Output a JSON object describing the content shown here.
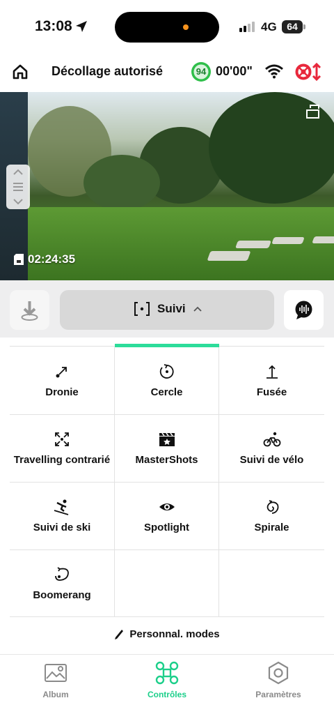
{
  "status_bar": {
    "time": "13:08",
    "network": "4G",
    "battery": "64",
    "signal_bars_active": 2,
    "signal_bars_total": 4
  },
  "header": {
    "title": "Décollage autorisé",
    "drone_battery": "94",
    "flight_time": "00'00\"",
    "icons": [
      "home-icon",
      "wifi-icon",
      "alert-icon"
    ]
  },
  "video": {
    "recording_time": "02:24:35"
  },
  "mode_selector": {
    "label": "Suivi"
  },
  "modes": [
    {
      "label": "Dronie",
      "icon": "dronie-icon"
    },
    {
      "label": "Cercle",
      "icon": "circle-icon"
    },
    {
      "label": "Fusée",
      "icon": "rocket-icon"
    },
    {
      "label": "Travelling contrarié",
      "icon": "travelling-icon"
    },
    {
      "label": "MasterShots",
      "icon": "clapper-icon"
    },
    {
      "label": "Suivi de vélo",
      "icon": "bike-icon"
    },
    {
      "label": "Suivi de ski",
      "icon": "ski-icon"
    },
    {
      "label": "Spotlight",
      "icon": "eye-icon"
    },
    {
      "label": "Spirale",
      "icon": "spiral-icon"
    },
    {
      "label": "Boomerang",
      "icon": "boomerang-icon"
    }
  ],
  "custom_modes_label": "Personnal. modes",
  "bottom_nav": {
    "album": "Album",
    "controls": "Contrôles",
    "settings": "Paramètres"
  },
  "colors": {
    "accent": "#1ccf8a",
    "alert": "#e8283c"
  }
}
